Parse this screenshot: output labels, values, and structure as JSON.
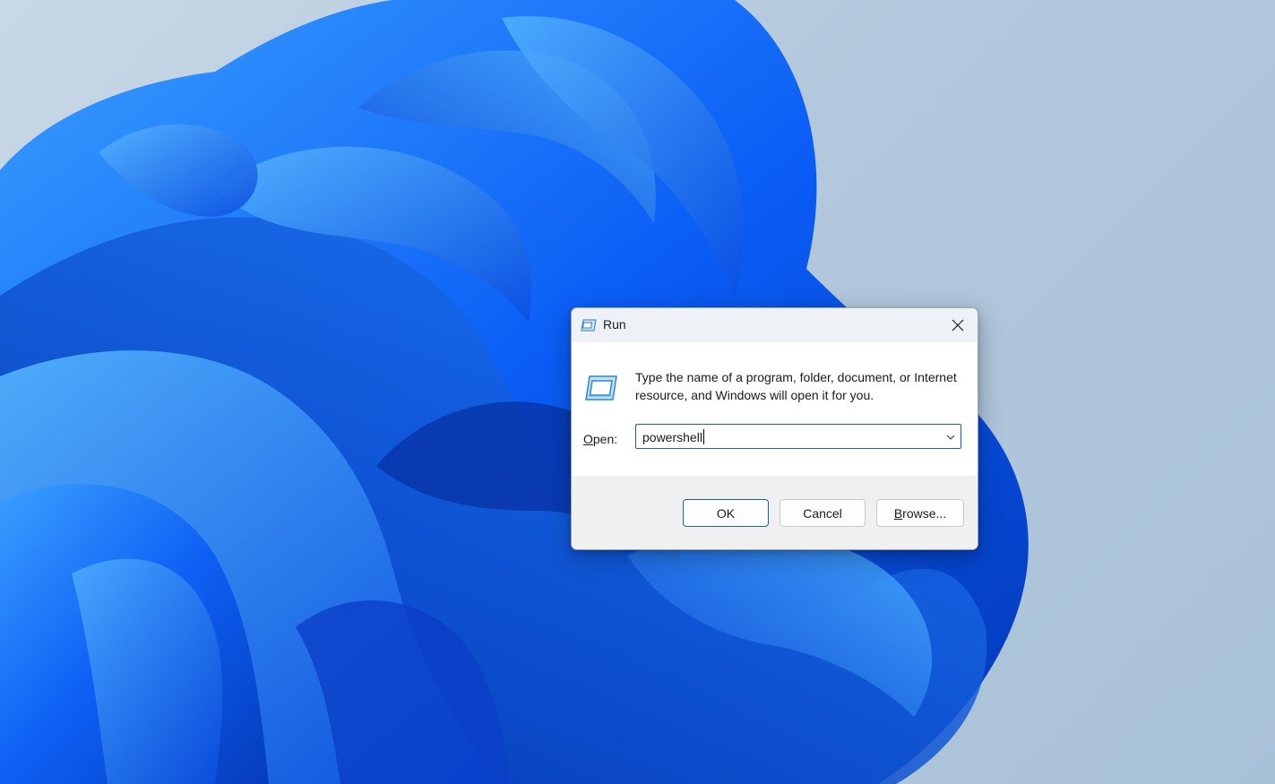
{
  "dialog": {
    "title": "Run",
    "title_icon": "run-icon",
    "close_icon": "close-icon",
    "description": "Type the name of a program, folder, document, or Internet resource, and Windows will open it for you.",
    "big_icon": "run-icon",
    "open_label_accel": "O",
    "open_label_rest": "pen:",
    "open_value": "powershell",
    "dropdown_icon": "chevron-down-icon"
  },
  "buttons": {
    "ok_label": "OK",
    "cancel_label": "Cancel",
    "browse_label_accel": "B",
    "browse_label_rest": "rowse..."
  },
  "colors": {
    "accent": "#1a5fb4",
    "wallpaper_blue": "#0a5cf5",
    "wallpaper_bg": "#b3c8dc"
  }
}
